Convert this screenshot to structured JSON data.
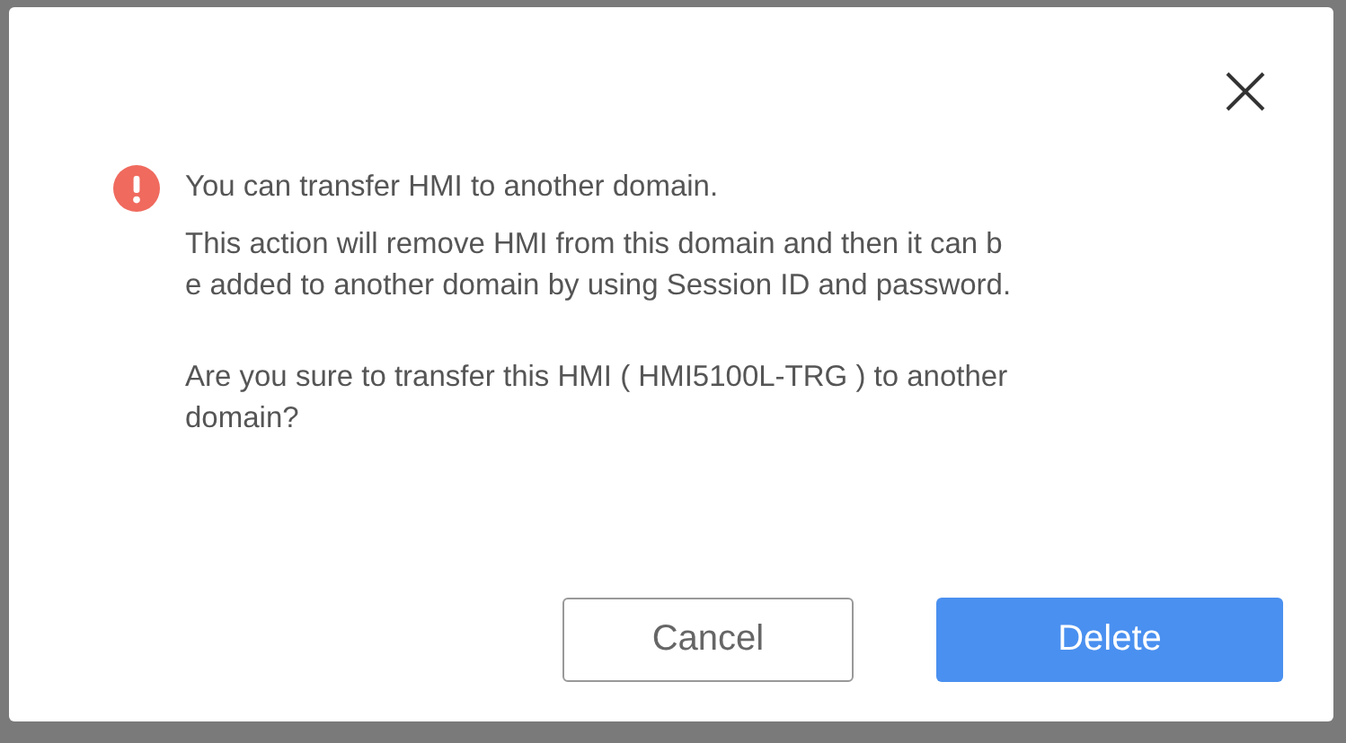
{
  "dialog": {
    "message": {
      "title": "You can transfer HMI to another domain.",
      "paragraphs": [
        {
          "lines": [
            "This action will remove HMI from this domain and then it can b",
            "e added to another domain by using Session ID and password."
          ]
        },
        {
          "lines": [
            "Are you sure to transfer this HMI ( HMI5100L-TRG ) to another",
            "domain?"
          ]
        }
      ]
    },
    "buttons": [
      {
        "label": "Cancel",
        "kind": "secondary"
      },
      {
        "label": "Delete",
        "kind": "primary"
      }
    ]
  }
}
